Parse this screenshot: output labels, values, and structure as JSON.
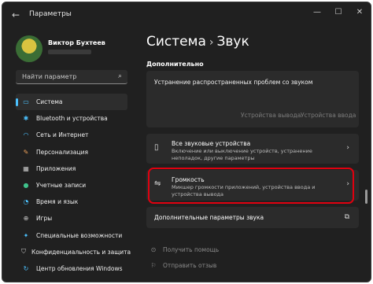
{
  "window": {
    "title": "Параметры",
    "back_icon": "arrow-left-icon",
    "controls": [
      "minimize",
      "maximize",
      "close"
    ]
  },
  "user": {
    "name": "Виктор Бухтеев"
  },
  "search": {
    "placeholder": "Найти параметр"
  },
  "sidebar": {
    "items": [
      {
        "label": "Система",
        "icon": "monitor-icon",
        "color": "#4cc2ff",
        "active": true
      },
      {
        "label": "Bluetooth и устройства",
        "icon": "bluetooth-icon",
        "color": "#4cc2ff",
        "active": false
      },
      {
        "label": "Сеть и Интернет",
        "icon": "wifi-icon",
        "color": "#4cc2ff",
        "active": false
      },
      {
        "label": "Персонализация",
        "icon": "brush-icon",
        "color": "#f0a35a",
        "active": false
      },
      {
        "label": "Приложения",
        "icon": "apps-icon",
        "color": "#c8c8c8",
        "active": false
      },
      {
        "label": "Учетные записи",
        "icon": "person-icon",
        "color": "#3fc28b",
        "active": false
      },
      {
        "label": "Время и язык",
        "icon": "globe-clock-icon",
        "color": "#4cc2ff",
        "active": false
      },
      {
        "label": "Игры",
        "icon": "gamepad-icon",
        "color": "#c8c8c8",
        "active": false
      },
      {
        "label": "Специальные возможности",
        "icon": "accessibility-icon",
        "color": "#4cc2ff",
        "active": false
      },
      {
        "label": "Конфиденциальность и защита",
        "icon": "shield-icon",
        "color": "#c8c8c8",
        "active": false
      },
      {
        "label": "Центр обновления Windows",
        "icon": "update-icon",
        "color": "#4cc2ff",
        "active": false
      }
    ]
  },
  "breadcrumb": {
    "parent": "Система",
    "separator": "›",
    "current": "Звук"
  },
  "section": {
    "title": "Дополнительно"
  },
  "troubleshoot": {
    "title": "Устранение распространенных проблем со звуком",
    "output_button": "Устройства вывода",
    "input_button": "Устройства ввода"
  },
  "rows": {
    "all_devices": {
      "title": "Все звуковые устройства",
      "description": "Включение или выключение устройств, устранение неполадок, другие параметры",
      "icon": "speaker-device-icon"
    },
    "volume_mixer": {
      "title": "Громкость",
      "description": "Микшер громкости приложений, устройства ввода и устройства вывода",
      "icon": "mixer-icon"
    },
    "more_settings": {
      "title": "Дополнительные параметры звука",
      "icon": "external-link-icon"
    }
  },
  "help": {
    "get_help": "Получить помощь",
    "feedback": "Отправить отзыв"
  },
  "colors": {
    "accent": "#4cc2ff",
    "highlight": "#e0000f",
    "background": "#202020",
    "card": "#2b2b2b"
  }
}
